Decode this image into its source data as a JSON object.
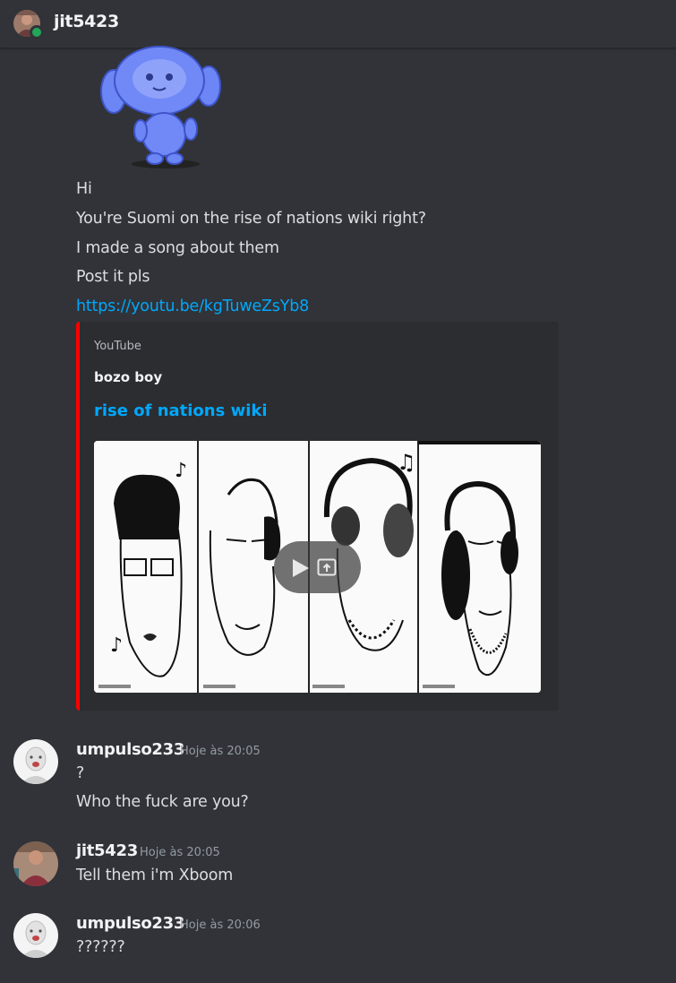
{
  "header": {
    "username": "jit5423",
    "status": "online",
    "status_color": "#23a55a"
  },
  "messages_block_1": {
    "sticker": "wumpus-sticker",
    "lines": [
      "Hi",
      "You're Suomi on the rise of nations wiki right?",
      "I made a song about them",
      "Post it pls"
    ],
    "link": "https://youtu.be/kgTuweZsYb8"
  },
  "embed": {
    "provider": "YouTube",
    "author": "bozo boy",
    "title": "rise of nations wiki",
    "accent_color": "#ff0000",
    "thumbnail": "four-headphone-caricatures",
    "play_icon": "play-icon",
    "popout_icon": "popout-icon"
  },
  "messages": [
    {
      "username": "umpulso233",
      "timestamp": "Hoje às 20:05",
      "lines": [
        "?",
        "Who the fuck are you?"
      ]
    },
    {
      "username": "jit5423",
      "timestamp": "Hoje às 20:05",
      "lines": [
        "Tell them i'm Xboom"
      ]
    },
    {
      "username": "umpulso233",
      "timestamp": "Hoje às 20:06",
      "lines": [
        "??????"
      ]
    }
  ],
  "colors": {
    "background": "#313338",
    "link": "#00a8fc",
    "text": "#dbdee1",
    "muted": "#949ba4"
  }
}
